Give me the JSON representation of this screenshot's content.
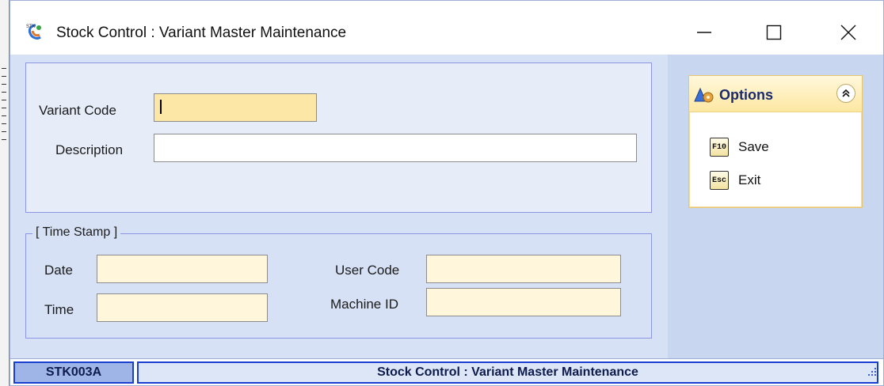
{
  "window": {
    "title": "Stock Control : Variant Master Maintenance",
    "app_icon": "stk-app-icon",
    "controls": {
      "minimize": "minimize-icon",
      "maximize": "maximize-icon",
      "close": "close-icon"
    }
  },
  "form": {
    "variant_code": {
      "label": "Variant Code",
      "value": ""
    },
    "description": {
      "label": "Description",
      "value": ""
    }
  },
  "time_stamp": {
    "legend": "[ Time Stamp ]",
    "date": {
      "label": "Date",
      "value": ""
    },
    "time": {
      "label": "Time",
      "value": ""
    },
    "user_code": {
      "label": "User Code",
      "value": ""
    },
    "machine_id": {
      "label": "Machine ID",
      "value": ""
    }
  },
  "options": {
    "title": "Options",
    "icon": "options-icon",
    "items": [
      {
        "key": "F10",
        "label": "Save"
      },
      {
        "key": "Esc",
        "label": "Exit"
      }
    ]
  },
  "status": {
    "code": "STK003A",
    "title": "Stock Control : Variant Master Maintenance"
  },
  "colors": {
    "key_field": "#fde7a6",
    "readonly_field": "#fff6dc",
    "panel_border": "#8c96e4",
    "status_border": "#1a3fd0",
    "options_header": "#fde7a2"
  }
}
